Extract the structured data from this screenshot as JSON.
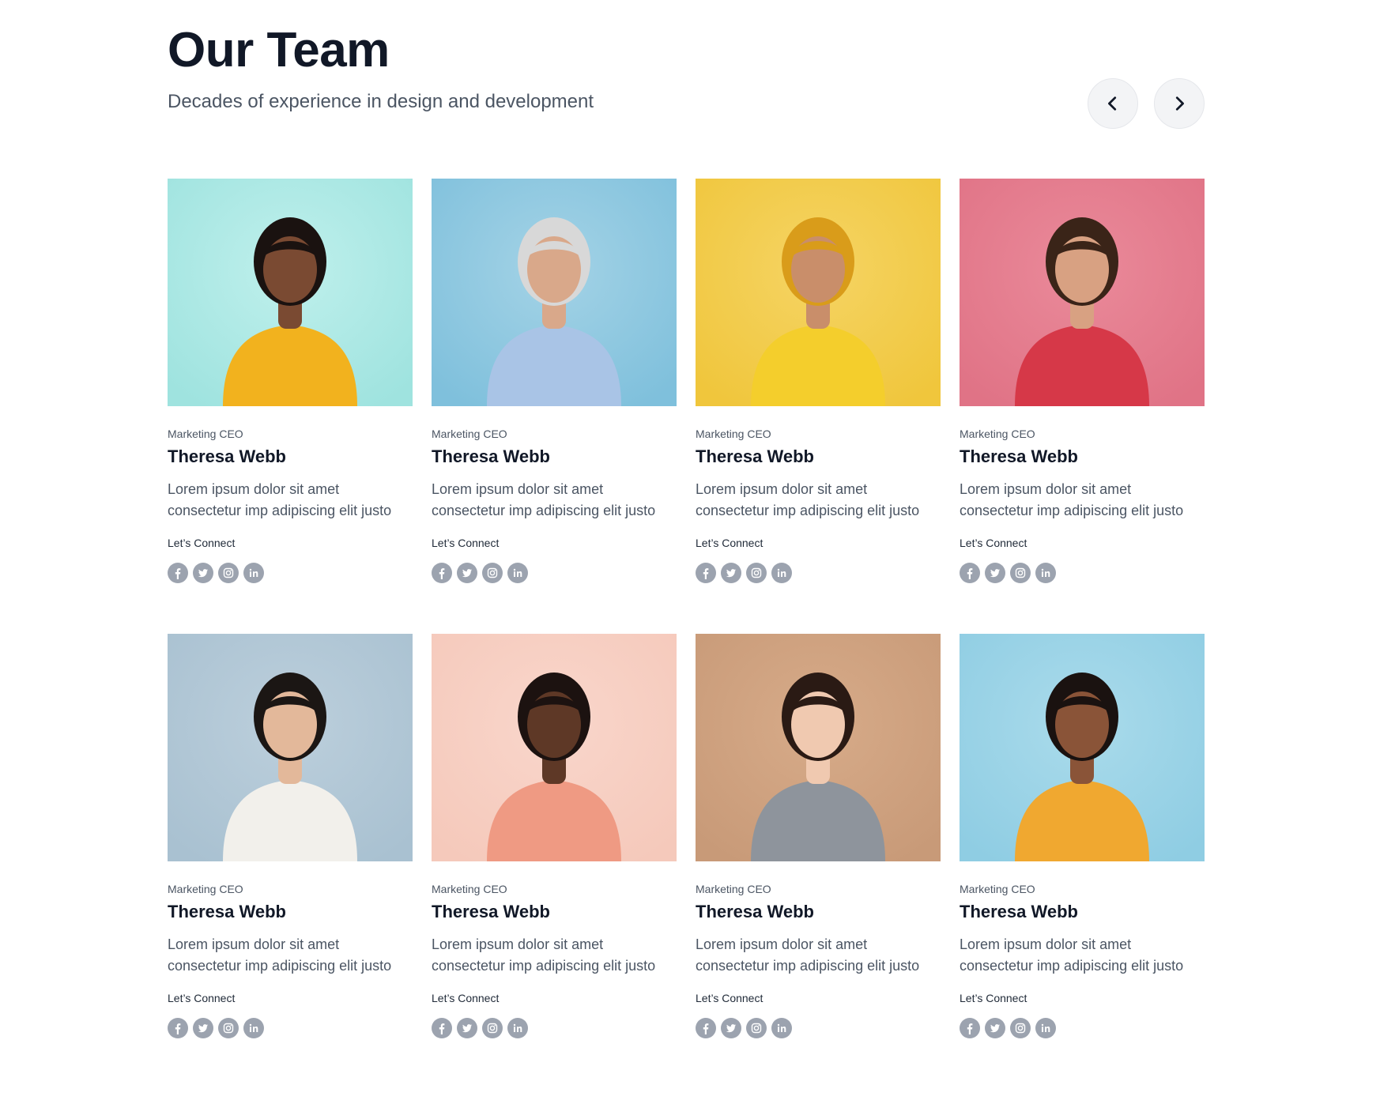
{
  "header": {
    "title": "Our Team",
    "subtitle": "Decades of experience in design and development",
    "prev_icon": "chevron-left-icon",
    "next_icon": "chevron-right-icon"
  },
  "colors": {
    "title": "#111827",
    "text": "#4b5563",
    "icon_bg": "#9ca3af",
    "nav_bg": "#f3f4f6"
  },
  "members": [
    {
      "role": "Marketing CEO",
      "name": "Theresa Webb",
      "bio": "Lorem ipsum dolor sit amet consectetur imp adipiscing elit justo",
      "connect": "Let’s Connect",
      "photo": {
        "bg": "#9fe3df",
        "bg2": "#bff0ec",
        "skin": "#7a4a32",
        "hair": "#1a1210",
        "shirt": "#f2b21e"
      }
    },
    {
      "role": "Marketing CEO",
      "name": "Theresa Webb",
      "bio": "Lorem ipsum dolor sit amet consectetur imp adipiscing elit justo",
      "connect": "Let’s Connect",
      "photo": {
        "bg": "#7fc0dc",
        "bg2": "#a4d3e6",
        "skin": "#d9a88a",
        "hair": "#d8d8d8",
        "shirt": "#a9c4e6"
      }
    },
    {
      "role": "Marketing CEO",
      "name": "Theresa Webb",
      "bio": "Lorem ipsum dolor sit amet consectetur imp adipiscing elit justo",
      "connect": "Let’s Connect",
      "photo": {
        "bg": "#f0c63c",
        "bg2": "#f5d464",
        "skin": "#c98e6a",
        "hair": "#d99c1a",
        "shirt": "#f4ce2c"
      }
    },
    {
      "role": "Marketing CEO",
      "name": "Theresa Webb",
      "bio": "Lorem ipsum dolor sit amet consectetur imp adipiscing elit justo",
      "connect": "Let’s Connect",
      "photo": {
        "bg": "#e07386",
        "bg2": "#ea8a9a",
        "skin": "#d8a182",
        "hair": "#3a2418",
        "shirt": "#d63848"
      }
    },
    {
      "role": "Marketing CEO",
      "name": "Theresa Webb",
      "bio": "Lorem ipsum dolor sit amet consectetur imp adipiscing elit justo",
      "connect": "Let’s Connect",
      "photo": {
        "bg": "#a9c1d1",
        "bg2": "#bccfdc",
        "skin": "#e3b89a",
        "hair": "#1b1614",
        "shirt": "#f2f0eb"
      }
    },
    {
      "role": "Marketing CEO",
      "name": "Theresa Webb",
      "bio": "Lorem ipsum dolor sit amet consectetur imp adipiscing elit justo",
      "connect": "Let’s Connect",
      "photo": {
        "bg": "#f5c9bb",
        "bg2": "#f9d6cb",
        "skin": "#5e3826",
        "hair": "#1c1210",
        "shirt": "#ef9a83"
      }
    },
    {
      "role": "Marketing CEO",
      "name": "Theresa Webb",
      "bio": "Lorem ipsum dolor sit amet consectetur imp adipiscing elit justo",
      "connect": "Let’s Connect",
      "photo": {
        "bg": "#c89a78",
        "bg2": "#d7ab89",
        "skin": "#f0c9b0",
        "hair": "#2a1a14",
        "shirt": "#8e949c"
      }
    },
    {
      "role": "Marketing CEO",
      "name": "Theresa Webb",
      "bio": "Lorem ipsum dolor sit amet consectetur imp adipiscing elit justo",
      "connect": "Let’s Connect",
      "photo": {
        "bg": "#8fcde3",
        "bg2": "#aadbeb",
        "skin": "#8a5438",
        "hair": "#1a1210",
        "shirt": "#f0a830"
      }
    }
  ],
  "social_icons": [
    "facebook-icon",
    "twitter-icon",
    "instagram-icon",
    "linkedin-icon"
  ]
}
